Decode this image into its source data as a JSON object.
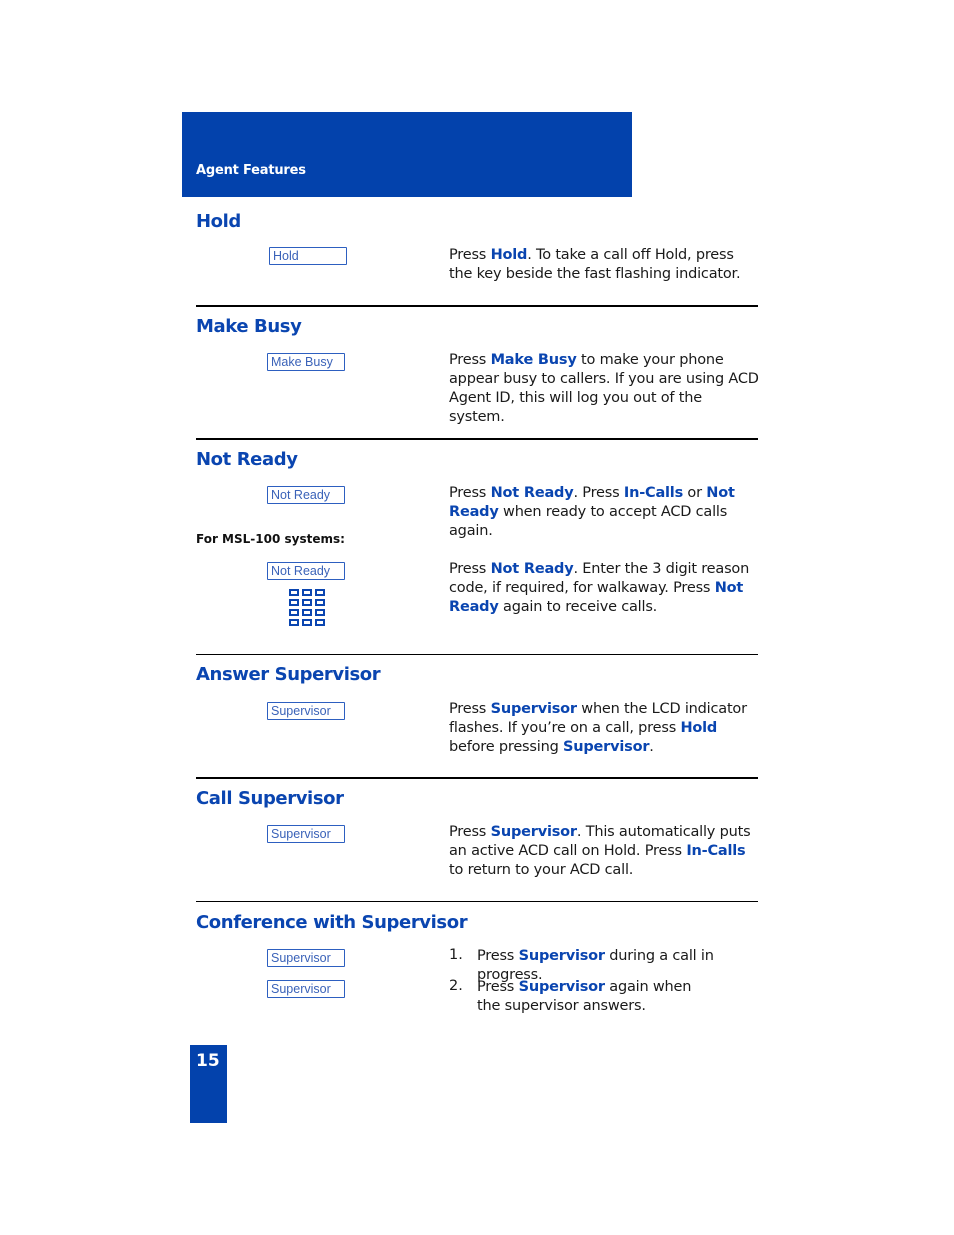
{
  "header": {
    "title": "Agent Features",
    "color": "#0342ac"
  },
  "accent_color": "#0a45b0",
  "sections": {
    "hold": {
      "title": "Hold",
      "key_label": "Hold",
      "desc": {
        "t1": "Press ",
        "b1": "Hold",
        "t2": ". To take a call  off Hold, press the key beside the fast flashing indicator."
      }
    },
    "make_busy": {
      "title": "Make Busy",
      "key_label": "Make Busy",
      "desc": {
        "t1": "Press ",
        "b1": "Make Busy",
        "t2": " to make your phone appear busy to callers. If you are using ACD Agent ID, this will log you out of the system."
      }
    },
    "not_ready": {
      "title": "Not Ready",
      "key_label": "Not Ready",
      "desc": {
        "t1": "Press ",
        "b1": "Not Ready",
        "t2": ". Press ",
        "b2": "In-Calls",
        "t3": " or ",
        "b3": "Not Ready",
        "t4": " when ready to accept ACD calls again."
      },
      "msl_subhead": "For MSL-100 systems:",
      "msl_key_label": "Not Ready",
      "msl_keypad_icon": "dialpad-icon",
      "msl_desc": {
        "t1": "Press ",
        "b1": "Not Ready",
        "t2": ". Enter the 3 digit reason code, if required, for walkaway. Press ",
        "b2": "Not Ready",
        "t3": " again to receive calls."
      }
    },
    "answer_supervisor": {
      "title": "Answer Supervisor",
      "key_label": "Supervisor",
      "desc": {
        "t1": "Press ",
        "b1": "Supervisor",
        "t2": " when the LCD indicator flashes. If you’re on a call, press ",
        "b2": "Hold",
        "t3": " before pressing ",
        "b3": "Supervisor",
        "t4": "."
      }
    },
    "call_supervisor": {
      "title": "Call Supervisor",
      "key_label": "Supervisor",
      "desc": {
        "t1": "Press ",
        "b1": "Supervisor",
        "t2": ". This automatically puts an active ACD call on Hold. Press ",
        "b2": "In-Calls",
        "t3": " to return to your ACD call."
      }
    },
    "conference_supervisor": {
      "title": "Conference with Supervisor",
      "steps": [
        {
          "num": "1.",
          "key_label": "Supervisor",
          "t1": "Press ",
          "b1": "Supervisor",
          "t2": " during a call in progress."
        },
        {
          "num": "2.",
          "key_label": "Supervisor",
          "t1": "Press ",
          "b1": "Supervisor",
          "t2": " again when the supervisor answers."
        }
      ]
    }
  },
  "page_number": "15"
}
